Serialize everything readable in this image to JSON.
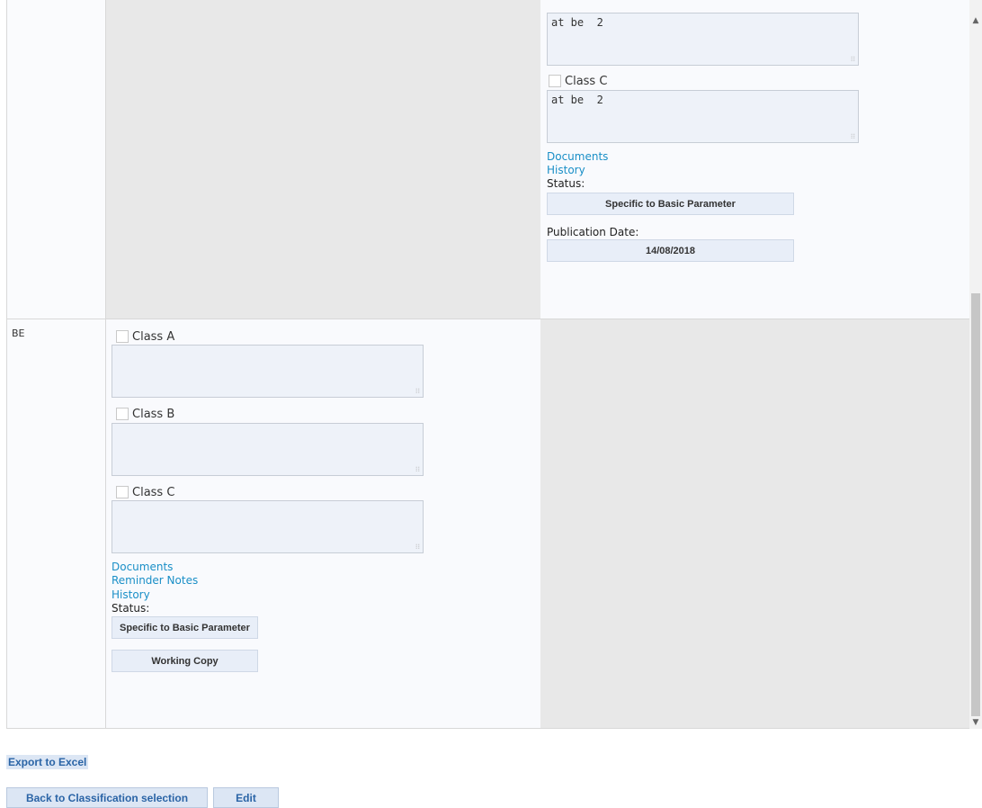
{
  "row1": {
    "classB_value": "at be  2",
    "classC_label": "Class C",
    "classC_value": "at be  2",
    "documents_link": "Documents",
    "history_link": "History",
    "status_label": "Status:",
    "status_value": "Specific to Basic Parameter",
    "pubdate_label": "Publication Date:",
    "pubdate_value": "14/08/2018"
  },
  "row2": {
    "country": "BE",
    "classA_label": "Class A",
    "classB_label": "Class B",
    "classC_label": "Class C",
    "documents_link": "Documents",
    "reminder_link": "Reminder Notes",
    "history_link": "History",
    "status_label": "Status:",
    "status_value": "Specific to Basic Parameter",
    "state_value": "Working Copy"
  },
  "footer": {
    "export_label": "Export to Excel",
    "back_label": "Back to Classification selection",
    "edit_label": "Edit"
  }
}
